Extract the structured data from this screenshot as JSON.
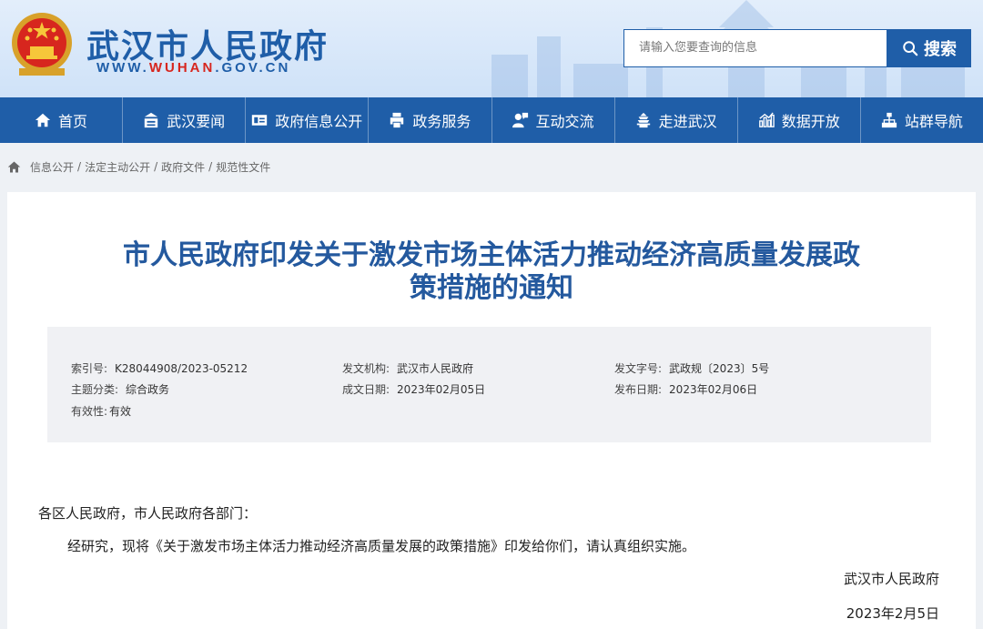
{
  "header": {
    "site_name": "武汉市人民政府",
    "site_url_prefix": "WWW.",
    "site_url_brand": "WUHAN",
    "site_url_suffix": ".GOV.CN",
    "search_placeholder": "请输入您要查询的信息",
    "search_button": "搜索"
  },
  "nav": [
    {
      "label": "首页",
      "icon": "home-icon"
    },
    {
      "label": "武汉要闻",
      "icon": "news-icon"
    },
    {
      "label": "政府信息公开",
      "icon": "id-card-icon"
    },
    {
      "label": "政务服务",
      "icon": "printer-icon"
    },
    {
      "label": "互动交流",
      "icon": "chat-person-icon"
    },
    {
      "label": "走进武汉",
      "icon": "tower-icon"
    },
    {
      "label": "数据开放",
      "icon": "bar-chart-icon"
    },
    {
      "label": "站群导航",
      "icon": "sitemap-icon"
    }
  ],
  "breadcrumb": [
    "信息公开",
    "法定主动公开",
    "政府文件",
    "规范性文件"
  ],
  "article": {
    "title_line1": "市人民政府印发关于激发市场主体活力推动经济高质量发展政",
    "title_line2": "策措施的通知",
    "meta": {
      "index_label": "索引号:",
      "index_value": "K28044908/2023-05212",
      "issuer_label": "发文机构:",
      "issuer_value": "武汉市人民政府",
      "docno_label": "发文字号:",
      "docno_value": "武政规〔2023〕5号",
      "category_label": "主题分类:",
      "category_value": "综合政务",
      "created_label": "成文日期:",
      "created_value": "2023年02月05日",
      "published_label": "发布日期:",
      "published_value": "2023年02月06日",
      "validity_label": "有效性:",
      "validity_value": "有效"
    },
    "salutation": "各区人民政府，市人民政府各部门：",
    "paragraph": "经研究，现将《关于激发市场主体活力推动经济高质量发展的政策措施》印发给你们，请认真组织实施。",
    "signature": "武汉市人民政府",
    "date": "2023年2月5日"
  },
  "colors": {
    "brand_blue": "#1f5ea8",
    "title_blue": "#24599e",
    "url_red": "#d7261e"
  }
}
